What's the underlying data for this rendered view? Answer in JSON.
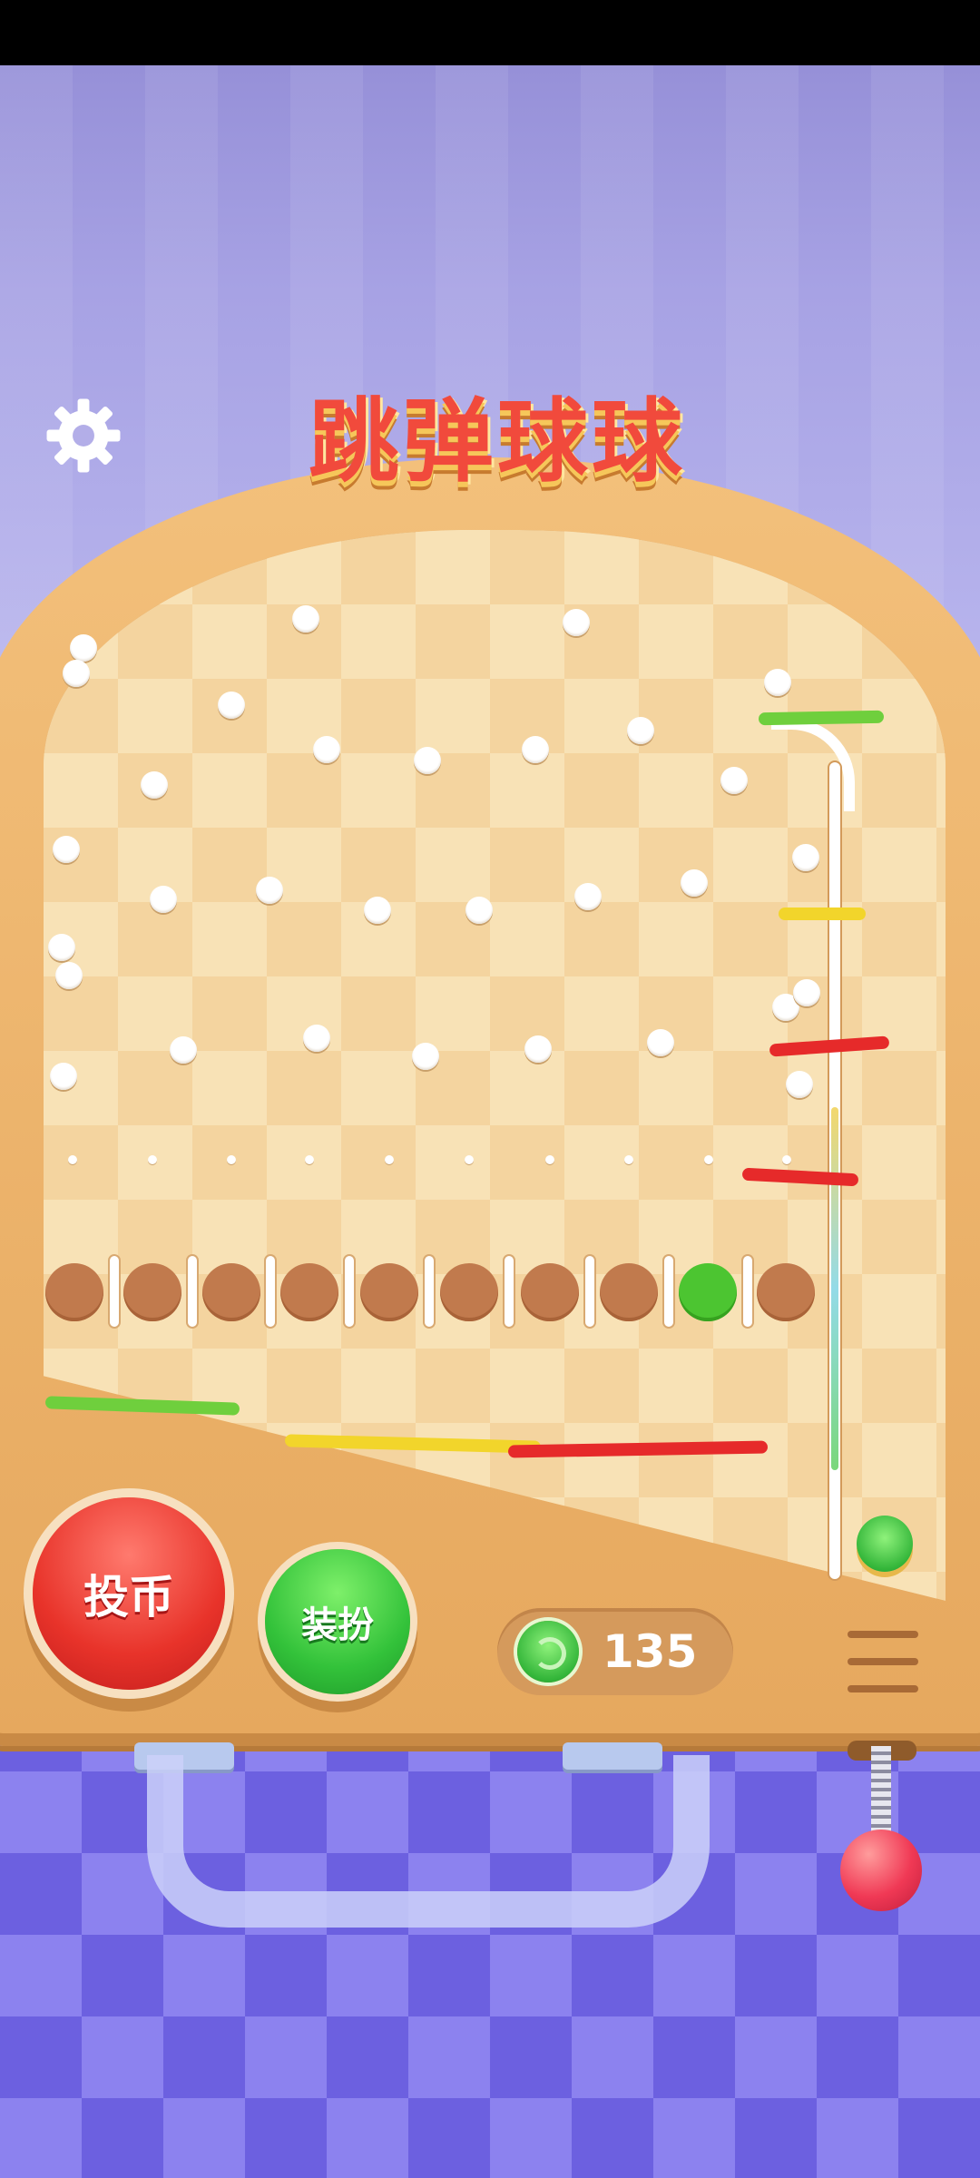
{
  "game": {
    "title": "跳弹球球",
    "coin_button_label": "投币",
    "dress_button_label": "装扮",
    "coin_balance": "135"
  },
  "icons": {
    "settings": "gear-icon",
    "menu": "menu-icon",
    "coin": "swirl-coin-icon"
  },
  "colors": {
    "coin_button": "#e8332a",
    "dress_button": "#33c23a",
    "board_frame": "#e6a85e",
    "active_slot": "#4cc531",
    "slot_ball": "#c17a4d"
  }
}
